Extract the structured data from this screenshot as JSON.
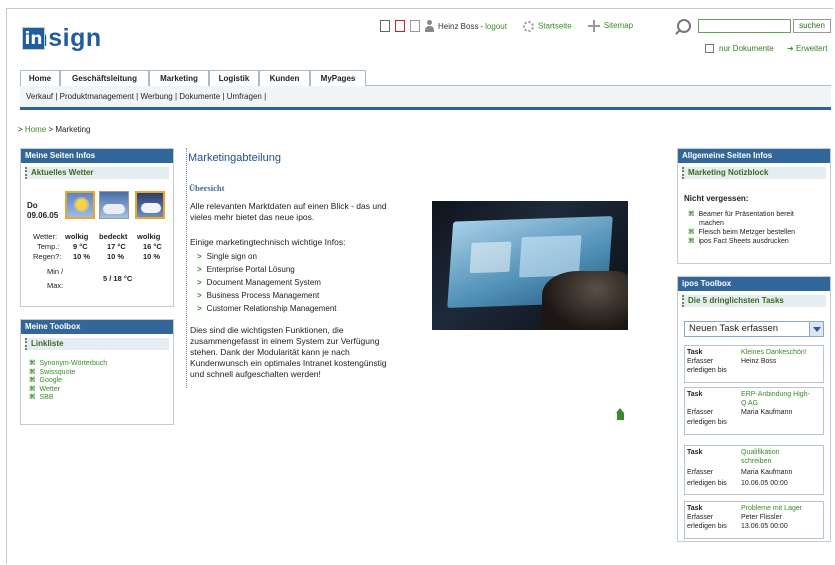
{
  "header": {
    "logo_box": "in",
    "logo_word": "insign",
    "user": "Heinz Boss",
    "logout": "logout",
    "startseite": "Startseite",
    "sitemap": "Sitemap",
    "search_button": "suchen",
    "nur_dokumente": "nur Dokumente",
    "erweitert": "Erweitert"
  },
  "tabs": [
    "Home",
    "Geschäftsleitung",
    "Marketing",
    "Logistik",
    "Kunden",
    "MyPages"
  ],
  "subnav": "Verkauf | Produktmanagement | Werbung | Dokumente | Umfragen |",
  "breadcrumb": {
    "home": "Home",
    "current": "Marketing"
  },
  "left": {
    "meine_seiten_infos": "Meine Seiten Infos",
    "aktuelles_wetter": "Aktuelles Wetter",
    "weather": {
      "day": "Do",
      "date": "09.06.05",
      "wetter_label": "Wetter:",
      "temp_label": "Temp.:",
      "regen_label": "Regen?:",
      "minmax_label_1": "Min /",
      "minmax_label_2": "Max:",
      "cols": [
        {
          "cond": "wolkig",
          "temp": "9 °C",
          "rain": "10 %"
        },
        {
          "cond": "bedeckt",
          "temp": "17 °C",
          "rain": "10 %"
        },
        {
          "cond": "wolkig",
          "temp": "16 °C",
          "rain": "10 %"
        }
      ],
      "minmax": "5 / 18 °C"
    },
    "meine_toolbox": "Meine Toolbox",
    "linkliste": "Linkliste",
    "links": [
      "Synonym-Wörterbuch",
      "Swissquote",
      "Google",
      "Wetter",
      "SBB"
    ]
  },
  "main": {
    "title": "Marketingabteilung",
    "subtitle": "Übersicht",
    "intro_1": "Alle relevanten Marktdaten auf einen Blick - das und",
    "intro_2": "vieles mehr bietet das neue ipos.",
    "list_intro": "Einige marketingtechnisch wichtige Infos:",
    "bullets": [
      "Single sign on",
      "Enterprise Portal Lösung",
      "Document Management System",
      "Business Process Management",
      "Customer Relationship Management"
    ],
    "outro": [
      "Dies sind die wichtigsten Funktionen, die",
      "zusammengefasst in einem System zur Verfügung",
      "stehen. Dank der Modularität kann je nach",
      "Kundenwunsch ein optimales Intranet kostengünstig",
      "und schnell aufgeschalten werden!"
    ]
  },
  "right": {
    "allgemeine": "Allgemeine Seiten Infos",
    "notizblock": "Marketing Notizblock",
    "nicht_vergessen": "Nicht vergessen:",
    "notes": [
      [
        "Beamer für Präsentation bereit",
        "machen"
      ],
      [
        "Fleisch beim Metzger bestellen"
      ],
      [
        "ipos Fact Sheets ausdrucken"
      ]
    ],
    "ipos_toolbox": "ipos Toolbox",
    "dringlichste": "Die 5 dringlichsten Tasks",
    "task_select": "Neuen Task erfassen",
    "label_task": "Task",
    "label_erfasser": "Erfasser",
    "label_erledigen": "erledigen bis",
    "tasks": [
      {
        "name": [
          "Kleines Dankeschön!"
        ],
        "erfasser": "Heinz Boss",
        "bis": ""
      },
      {
        "name": [
          "ERP-Anbindung High-",
          "Q AG"
        ],
        "erfasser": "Maria Kaufmann",
        "bis": ""
      },
      {
        "name": [
          "Qualifikation",
          "schreiben"
        ],
        "erfasser": "Maria Kaufmann",
        "bis": "10.06.05 00:00"
      },
      {
        "name": [
          "Probleme mit Lager"
        ],
        "erfasser": "Peter Flissler",
        "bis": "13.06.05 00:00"
      }
    ]
  }
}
